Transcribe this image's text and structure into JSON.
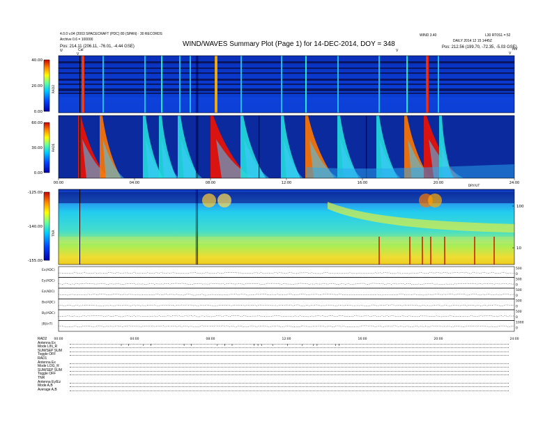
{
  "header": {
    "left_line1": "4.0.0 v.04 (2003 SPACECRAFT (PDC) 80 (SPAN) · 30 RECORDS",
    "left_line2": "Archive 0.6 = 100000",
    "left_line3": "Pos:  214.11 (206.11, -76.01, -4.44 GSE)",
    "title": "WIND/WAVES Summary Plot (Page 1) for 14-DEC-2014, DOY = 348",
    "right_line1a": "WIND 3.40",
    "right_line1b": "L30 RT0S1 = 52",
    "right_line2": "DAILY 2014 12 15 1445Z",
    "right_line3": "Pos:  212.56 (199.70, -72.35, -5.03 GSE)",
    "marker_v_left": "V",
    "marker_cal": "Cal",
    "marker_left_top": "\\l/",
    "marker_right_v": "V",
    "marker_right_top": "mV"
  },
  "chart_data": [
    {
      "type": "heatmap",
      "name_label": "RAD2",
      "colorbar_ticks": [
        "40.00",
        "20.00",
        "0.00"
      ],
      "ylim": [
        0,
        40
      ]
    },
    {
      "type": "heatmap",
      "name_label": "RAD1",
      "colorbar_ticks": [
        "60.00",
        "30.00",
        "0.00"
      ],
      "ylim": [
        0,
        60
      ],
      "time_ticks": [
        "00:00",
        "04:00",
        "08:00",
        "12:00",
        "16:00",
        "20:00",
        "24:00"
      ],
      "corner_label": "DRY/UT"
    },
    {
      "type": "heatmap",
      "name_label": "TNR",
      "colorbar_ticks": [
        "-125.00",
        "-140.00",
        "-155.00"
      ],
      "ylim": [
        -155,
        -125
      ],
      "right_ticks": [
        "100",
        "10"
      ]
    },
    {
      "type": "line",
      "x_ticks": [
        "00:00",
        "04:00",
        "08:00",
        "12:00",
        "16:00",
        "20:00",
        "24:00"
      ],
      "series": [
        {
          "name": "Ex(ADC)",
          "right_ticks": [
            "500",
            "0"
          ]
        },
        {
          "name": "Ey(ADC)",
          "right_ticks": [
            "500",
            "0"
          ]
        },
        {
          "name": "Ez(ADC)",
          "right_ticks": [
            "500",
            "0"
          ]
        },
        {
          "name": "Bx(ADC)",
          "right_ticks": [
            "500",
            "0"
          ]
        },
        {
          "name": "By(ADC)",
          "right_ticks": [
            "500",
            "0"
          ]
        },
        {
          "name": "|B|(nT)",
          "right_ticks": [
            "1000",
            "0"
          ]
        }
      ]
    }
  ],
  "status": {
    "rows": [
      "RAD2",
      "Antenna  Ex",
      "Mode  LIN_R",
      "SUM/SEP  SUM",
      "Toggle  OFF",
      "RAD1",
      "Antenna  Ex",
      "Mode  LOG_R",
      "SUM/SEP  SUM",
      "Toggle  OFF",
      "TNR",
      "Antenna  Ey/Ez",
      "Mode  A,B",
      "Average  A,B"
    ]
  }
}
